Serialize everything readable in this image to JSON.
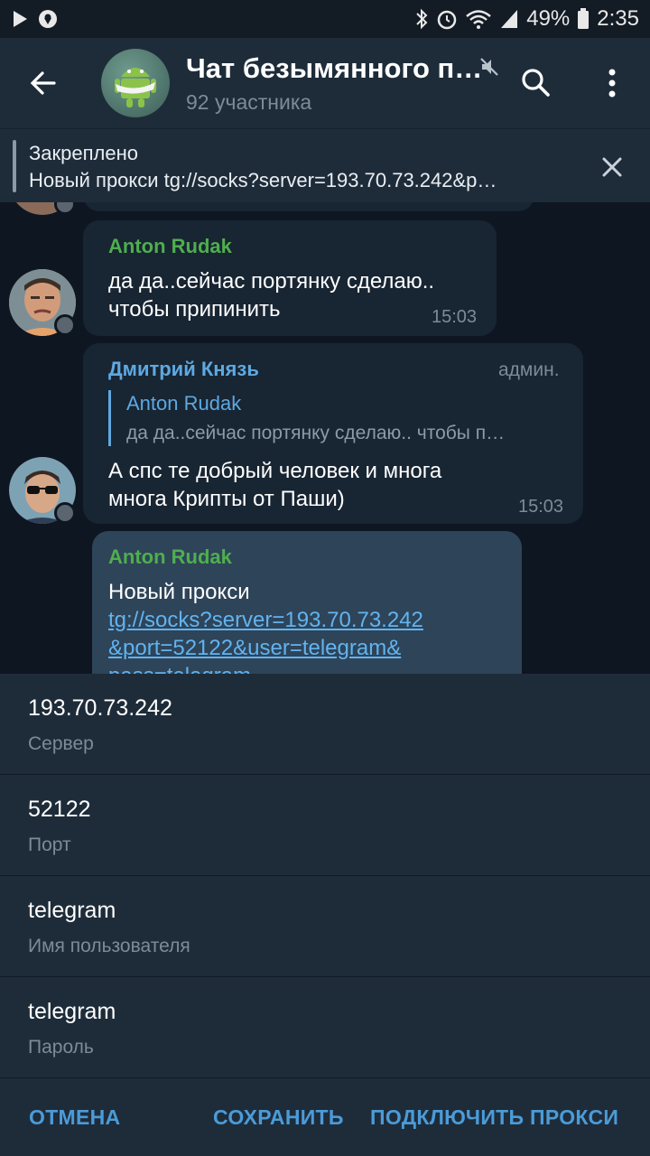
{
  "status_bar": {
    "battery": "49%",
    "time": "2:35",
    "icons": [
      "play-icon",
      "location-icon",
      "bluetooth-icon",
      "alarm-icon",
      "wifi-icon",
      "signal-icon",
      "battery-icon"
    ]
  },
  "header": {
    "title": "Чат безымянного п…",
    "subtitle": "92 участника"
  },
  "pinned": {
    "title": "Закреплено",
    "text": "Новый прокси tg://socks?server=193.70.73.242&p…"
  },
  "messages": [
    {
      "author": "Anton Rudak",
      "text_lines": [
        "да да..сейчас портянку сделаю..",
        "чтобы припинить"
      ],
      "time": "15:03"
    },
    {
      "author": "Дмитрий Князь",
      "badge": "админ.",
      "reply_author": "Anton Rudak",
      "reply_text": "да да..сейчас портянку сделаю.. чтобы п…",
      "text_lines": [
        "А спс те добрый человек и многа",
        "многа Крипты от Паши)"
      ],
      "time": "15:03"
    },
    {
      "author": "Anton Rudak",
      "text": "Новый прокси",
      "link_lines": [
        "tg://socks?server=193.70.73.242",
        "&port=52122&user=telegram&",
        "pass=telegram"
      ]
    }
  ],
  "proxy_sheet": {
    "fields": [
      {
        "value": "193.70.73.242",
        "label": "Сервер"
      },
      {
        "value": "52122",
        "label": "Порт"
      },
      {
        "value": "telegram",
        "label": "Имя пользователя"
      },
      {
        "value": "telegram",
        "label": "Пароль"
      }
    ],
    "cancel_label": "ОТМЕНА",
    "save_label": "СОХРАНИТЬ",
    "connect_label": "ПОДКЛЮЧИТЬ ПРОКСИ"
  },
  "colors": {
    "accent": "#4b9bd8",
    "name_green": "#4fae4e",
    "name_blue": "#5ea9e1",
    "link": "#62b3ef"
  }
}
